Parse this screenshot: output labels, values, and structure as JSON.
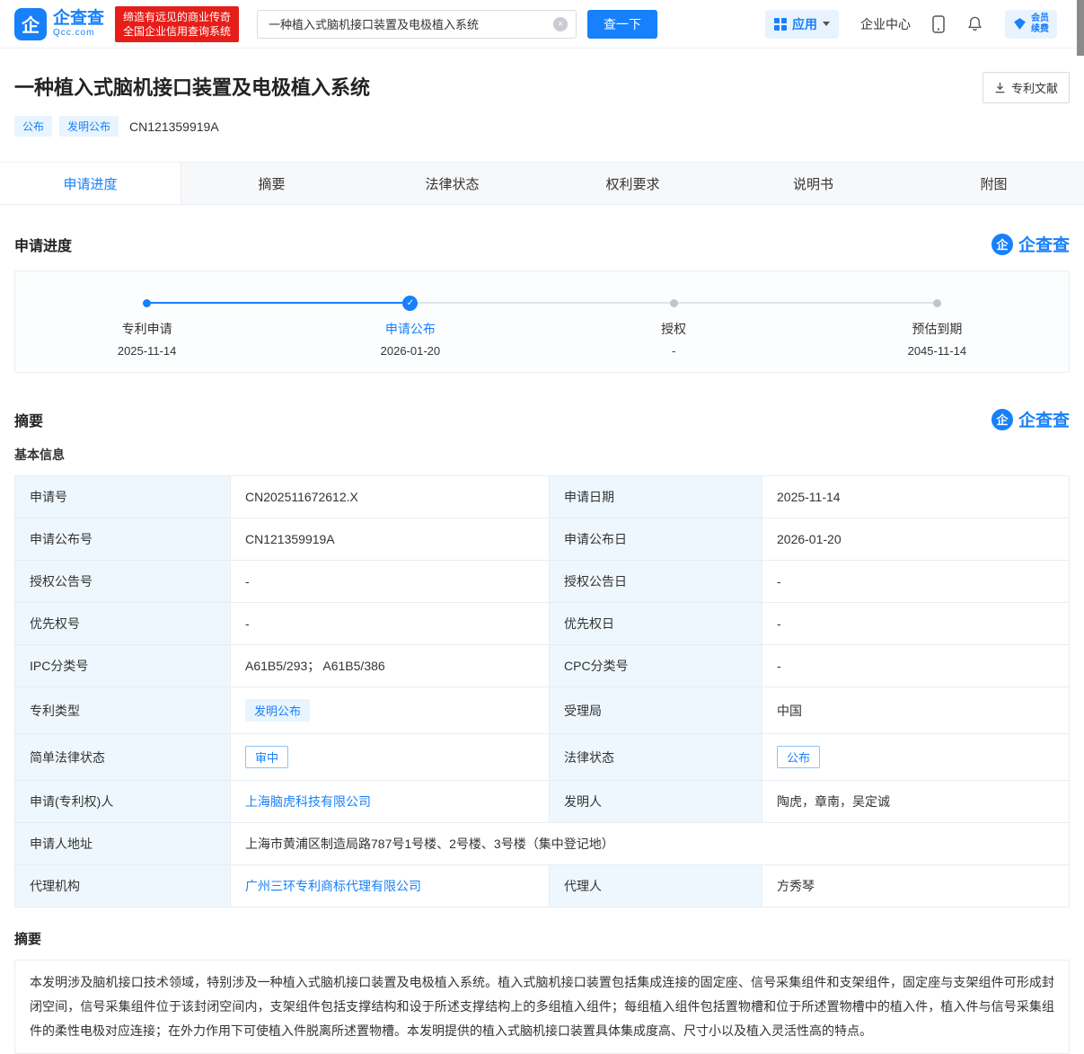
{
  "colors": {
    "accent": "#1780fb",
    "brand_red": "#e61e19",
    "label_bg": "#eef7fe"
  },
  "icons": {
    "check": "✓",
    "clear": "×",
    "logo_glyph": "企"
  },
  "header": {
    "logo": {
      "text": "企查查",
      "domain": "Qcc.com"
    },
    "slogan": {
      "line1": "缔造有远见的商业传奇",
      "line2": "全国企业信用查询系统"
    },
    "search": {
      "value": "一种植入式脑机接口装置及电极植入系统",
      "button_label": "查一下"
    },
    "nav": {
      "apps_label": "应用",
      "enterprise_center": "企业中心",
      "member_line1": "会员",
      "member_line2": "续费"
    }
  },
  "title_section": {
    "title": "一种植入式脑机接口装置及电极植入系统",
    "tags": [
      "公布",
      "发明公布"
    ],
    "publication_no": "CN121359919A",
    "doc_button_label": "专利文献"
  },
  "tabs": [
    {
      "label": "申请进度"
    },
    {
      "label": "摘要"
    },
    {
      "label": "法律状态"
    },
    {
      "label": "权利要求"
    },
    {
      "label": "说明书"
    },
    {
      "label": "附图"
    }
  ],
  "progress_section": {
    "heading": "申请进度",
    "watermark": "企查查",
    "steps": [
      {
        "label": "专利申请",
        "date": "2025-11-14",
        "state": "done"
      },
      {
        "label": "申请公布",
        "date": "2026-01-20",
        "state": "current"
      },
      {
        "label": "授权",
        "date": "-",
        "state": "pending"
      },
      {
        "label": "预估到期",
        "date": "2045-11-14",
        "state": "pending"
      }
    ]
  },
  "summary_section": {
    "heading": "摘要",
    "watermark": "企查查",
    "basic_info_heading": "基本信息",
    "rows": [
      {
        "l1": "申请号",
        "v1": "CN202511672612.X",
        "l2": "申请日期",
        "v2": "2025-11-14"
      },
      {
        "l1": "申请公布号",
        "v1": "CN121359919A",
        "l2": "申请公布日",
        "v2": "2026-01-20"
      },
      {
        "l1": "授权公告号",
        "v1": "-",
        "l2": "授权公告日",
        "v2": "-"
      },
      {
        "l1": "优先权号",
        "v1": "-",
        "l2": "优先权日",
        "v2": "-"
      },
      {
        "l1": "IPC分类号",
        "v1": "A61B5/293； A61B5/386",
        "l2": "CPC分类号",
        "v2": "-"
      },
      {
        "l1": "专利类型",
        "v1": "发明公布",
        "l2": "受理局",
        "v2": "中国"
      },
      {
        "l1": "简单法律状态",
        "v1": "审中",
        "l2": "法律状态",
        "v2": "公布"
      },
      {
        "l1": "申请(专利权)人",
        "v1": "上海脑虎科技有限公司",
        "l2": "发明人",
        "v2": "陶虎，章南，吴定诚"
      },
      {
        "l1": "申请人地址",
        "v1": "上海市黄浦区制造局路787号1号楼、2号楼、3号楼（集中登记地）"
      },
      {
        "l1": "代理机构",
        "v1": "广州三环专利商标代理有限公司",
        "l2": "代理人",
        "v2": "方秀琴"
      }
    ]
  },
  "abstract_section": {
    "heading": "摘要",
    "text": "本发明涉及脑机接口技术领域，特别涉及一种植入式脑机接口装置及电极植入系统。植入式脑机接口装置包括集成连接的固定座、信号采集组件和支架组件，固定座与支架组件可形成封闭空间，信号采集组件位于该封闭空间内，支架组件包括支撑结构和设于所述支撑结构上的多组植入组件；每组植入组件包括置物槽和位于所述置物槽中的植入件，植入件与信号采集组件的柔性电极对应连接；在外力作用下可使植入件脱离所述置物槽。本发明提供的植入式脑机接口装置具体集成度高、尺寸小以及植入灵活性高的特点。"
  }
}
